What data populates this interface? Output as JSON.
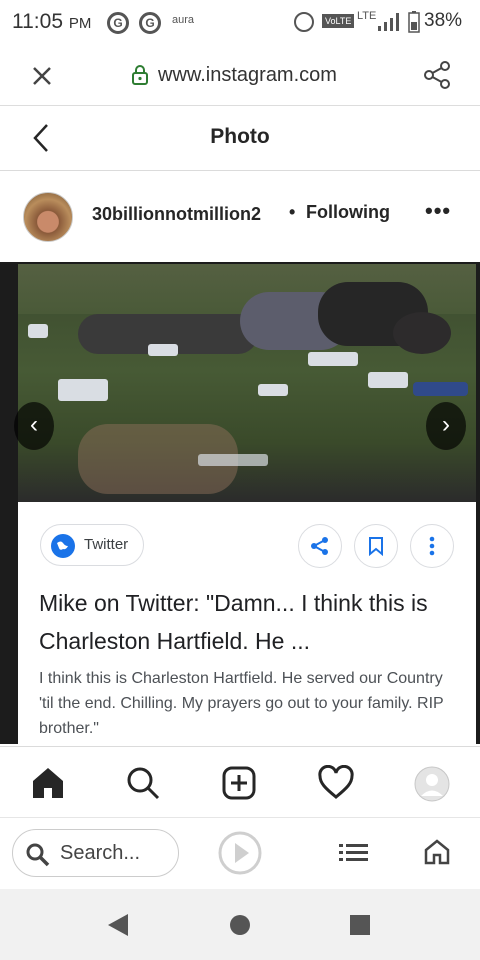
{
  "status_bar": {
    "time": "11:05",
    "ampm": "PM",
    "g1": "G",
    "g2": "G",
    "aura": "aura",
    "volte": "VoLTE",
    "lte": "LTE",
    "battery": "38%"
  },
  "browser": {
    "url": "www.instagram.com"
  },
  "header": {
    "title": "Photo"
  },
  "post": {
    "username": "30billionnotmillion2",
    "separator": "•",
    "following": "Following",
    "more": "•••"
  },
  "card": {
    "chip_label": "Twitter",
    "headline": "Mike on Twitter: \"Damn... I think this is Charleston Hartfield. He ...",
    "description": "I think this is Charleston Hartfield. He served our Country 'til the end. Chilling. My prayers go out to your family. RIP brother.\""
  },
  "bottom_browser": {
    "search_placeholder": "Search..."
  },
  "colors": {
    "accent": "#1a73e8",
    "lock": "#2e7d32"
  }
}
